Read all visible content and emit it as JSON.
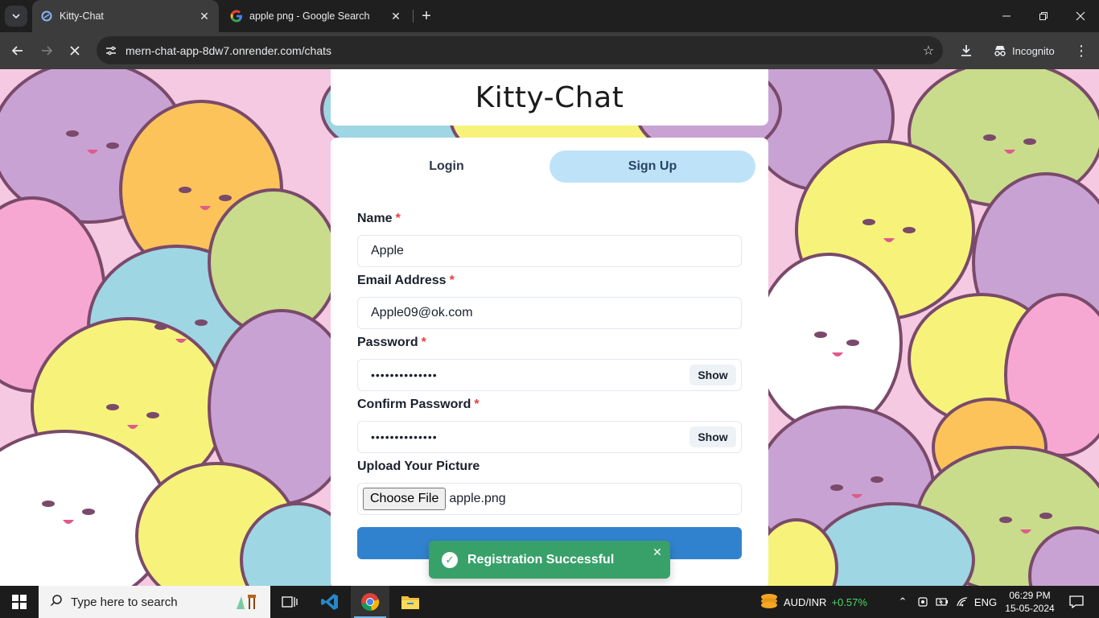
{
  "browser": {
    "tabs": [
      {
        "title": "Kitty-Chat",
        "active": true
      },
      {
        "title": "apple png - Google Search",
        "active": false
      }
    ],
    "url": "mern-chat-app-8dw7.onrender.com/chats",
    "profile_label": "Incognito"
  },
  "page": {
    "app_title": "Kitty-Chat",
    "tabs": {
      "login": "Login",
      "signup": "Sign Up",
      "selected": "signup"
    },
    "form": {
      "name_label": "Name",
      "name_value": "Apple",
      "email_label": "Email Address",
      "email_value": "Apple09@ok.com",
      "password_label": "Password",
      "password_mask": "••••••••••••••",
      "confirm_label": "Confirm Password",
      "confirm_mask": "••••••••••••••",
      "show_label": "Show",
      "picture_label": "Upload Your Picture",
      "choose_file_label": "Choose File",
      "file_name": "apple.png",
      "required_mark": "*"
    },
    "toast": {
      "message": "Registration Successful",
      "status": "success"
    }
  },
  "taskbar": {
    "search_placeholder": "Type here to search",
    "ticker_symbol": "AUD/INR",
    "ticker_change": "+0.57%",
    "language": "ENG",
    "time": "06:29 PM",
    "date": "15-05-2024"
  },
  "colors": {
    "primary_button": "#3182ce",
    "selected_tab": "#bee3f8",
    "toast_success": "#38a169",
    "required": "#e53e3e"
  }
}
